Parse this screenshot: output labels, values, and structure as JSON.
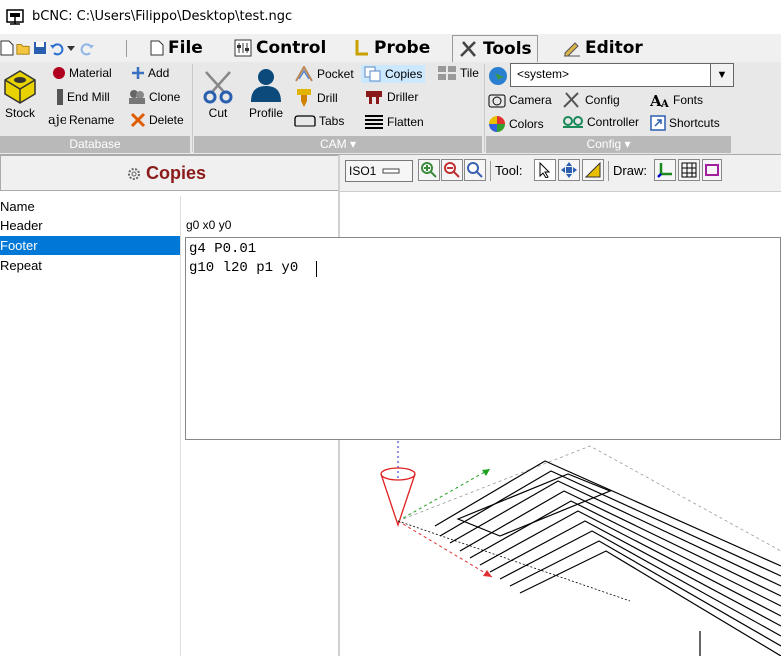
{
  "window": {
    "title": "bCNC: C:\\Users\\Filippo\\Desktop\\test.ngc"
  },
  "menu": {
    "tabs": [
      "File",
      "Control",
      "Probe",
      "Tools",
      "Editor"
    ],
    "active_tab": "Tools"
  },
  "ribbon": {
    "database": {
      "stock": "Stock",
      "material": "Material",
      "end_mill": "End Mill",
      "rename": "Rename",
      "add": "Add",
      "clone": "Clone",
      "delete": "Delete",
      "group_label": "Database"
    },
    "cam": {
      "cut": "Cut",
      "profile": "Profile",
      "pocket": "Pocket",
      "drill": "Drill",
      "tabs": "Tabs",
      "copies": "Copies",
      "driller": "Driller",
      "flatten": "Flatten",
      "tile": "Tile",
      "group_label": "CAM"
    },
    "config": {
      "combo_value": "<system>",
      "camera": "Camera",
      "config": "Config",
      "fonts": "Fonts",
      "colors": "Colors",
      "controller": "Controller",
      "shortcuts": "Shortcuts",
      "group_label": "Config"
    }
  },
  "panel": {
    "title": "Copies",
    "properties": [
      "Name",
      "Header",
      "Footer",
      "Repeat"
    ],
    "selected": "Footer",
    "header_value": "g0 x0 y0",
    "editor_lines": [
      "g4 P0.01",
      "g10 l20 p1 y0"
    ]
  },
  "canvas_toolbar": {
    "view": "ISO1",
    "tool_label": "Tool:",
    "draw_label": "Draw:"
  }
}
